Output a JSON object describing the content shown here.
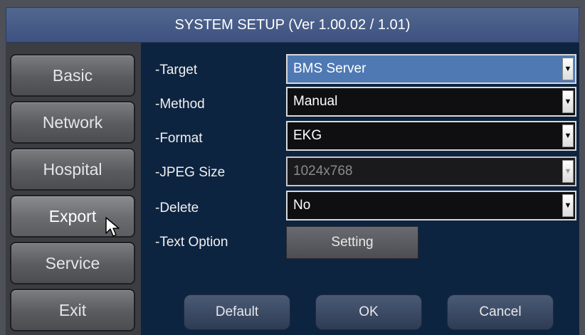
{
  "window": {
    "title": "SYSTEM SETUP (Ver 1.00.02 / 1.01)"
  },
  "sidebar": {
    "items": [
      {
        "label": "Basic"
      },
      {
        "label": "Network"
      },
      {
        "label": "Hospital"
      },
      {
        "label": "Export"
      },
      {
        "label": "Service"
      },
      {
        "label": "Exit"
      }
    ]
  },
  "form": {
    "target": {
      "label": "-Target",
      "value": "BMS Server"
    },
    "method": {
      "label": "-Method",
      "value": "Manual"
    },
    "format": {
      "label": "-Format",
      "value": "EKG"
    },
    "jpeg_size": {
      "label": "-JPEG Size",
      "value": "1024x768"
    },
    "delete": {
      "label": "-Delete",
      "value": "No"
    },
    "text_option": {
      "label": "-Text Option",
      "button": "Setting"
    }
  },
  "actions": {
    "default": "Default",
    "ok": "OK",
    "cancel": "Cancel"
  },
  "icons": {
    "dropdown": "chevron-down-icon",
    "cursor": "mouse-pointer-icon"
  },
  "colors": {
    "title_bar": "#4a5f8a",
    "content_bg": "#0d2440",
    "selected_combo": "#4f79b3"
  }
}
